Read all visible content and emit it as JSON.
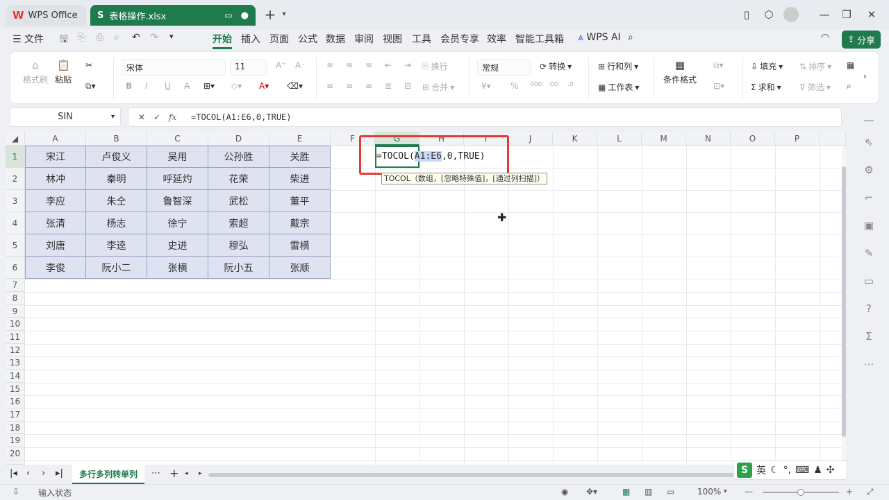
{
  "tabs": {
    "home": "WPS Office",
    "file": "表格操作.xlsx"
  },
  "menu": {
    "file": "文件",
    "items": [
      "开始",
      "插入",
      "页面",
      "公式",
      "数据",
      "审阅",
      "视图",
      "工具",
      "会员专享",
      "效率",
      "智能工具箱"
    ],
    "wps_ai": "WPS AI",
    "share": "分享"
  },
  "ribbon": {
    "format_painter": "格式刷",
    "paste": "粘贴",
    "font": "宋体",
    "font_size": "11",
    "wrap": "换行",
    "merge": "合并",
    "number_format": "常规",
    "convert": "转换",
    "rows_cols": "行和列",
    "worksheet": "工作表",
    "cond_format": "条件格式",
    "fill": "填充",
    "sort": "排序",
    "sum": "求和",
    "filter": "筛选"
  },
  "formula_bar": {
    "name_box": "SIN",
    "formula": "=TOCOL(A1:E6,0,TRUE)"
  },
  "columns": [
    "A",
    "B",
    "C",
    "D",
    "E",
    "F",
    "G",
    "H",
    "I",
    "J",
    "K",
    "L",
    "M",
    "N",
    "O",
    "P"
  ],
  "rows": [
    "1",
    "2",
    "3",
    "4",
    "5",
    "6",
    "7",
    "8",
    "9",
    "10",
    "11",
    "12",
    "13",
    "14",
    "15",
    "16",
    "17",
    "18",
    "19",
    "20"
  ],
  "cells": [
    [
      "宋江",
      "卢俊义",
      "吴用",
      "公孙胜",
      "关胜"
    ],
    [
      "林冲",
      "秦明",
      "呼延灼",
      "花荣",
      "柴进"
    ],
    [
      "李应",
      "朱仝",
      "鲁智深",
      "武松",
      "董平"
    ],
    [
      "张清",
      "杨志",
      "徐宁",
      "索超",
      "戴宗"
    ],
    [
      "刘唐",
      "李逵",
      "史进",
      "穆弘",
      "雷横"
    ],
    [
      "李俊",
      "阮小二",
      "张横",
      "阮小五",
      "张顺"
    ]
  ],
  "editing": {
    "prefix": "=TOCOL(",
    "range": "A1:E6",
    "suffix": ",0,TRUE)"
  },
  "tooltip": "TOCOL（数组，[忽略特殊值]，[通过列扫描]）",
  "sheet_tab": "多行多列转单列",
  "ime": {
    "label": "英"
  },
  "status": {
    "mode": "输入状态",
    "zoom": "100%"
  },
  "colors": {
    "accent": "#1f7a4d",
    "highlight_red": "#e53935",
    "selection": "#dfe3f1"
  }
}
